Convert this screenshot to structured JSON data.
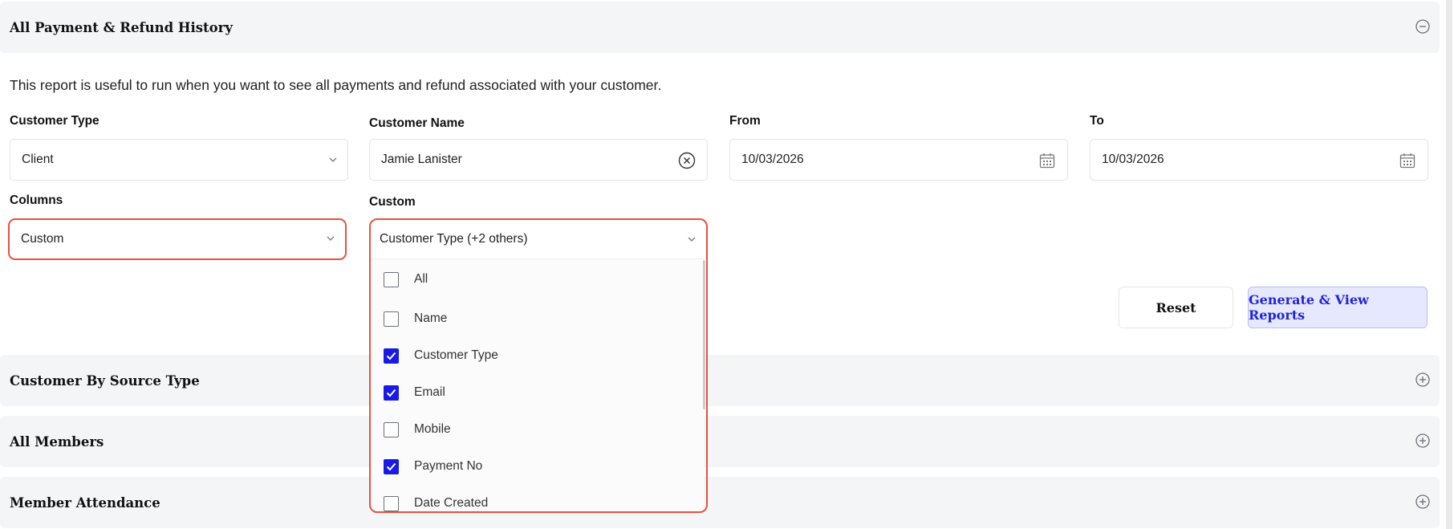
{
  "sections": {
    "payment_refund": {
      "title": "All Payment & Refund History",
      "icon": "minus-circle-icon"
    },
    "source_type": {
      "title": "Customer By Source Type",
      "icon": "plus-circle-icon"
    },
    "all_members": {
      "title": "All Members",
      "icon": "plus-circle-icon"
    },
    "member_attendance": {
      "title": "Member Attendance",
      "icon": "plus-circle-icon"
    }
  },
  "description": "This report is useful to run when you want to see all payments and refund associated with your customer.",
  "form": {
    "customer_type": {
      "label": "Customer Type",
      "value": "Client"
    },
    "customer_name": {
      "label": "Customer Name",
      "value": "Jamie Lanister"
    },
    "from": {
      "label": "From",
      "value": "10/03/2026"
    },
    "to": {
      "label": "To",
      "value": "10/03/2026"
    },
    "columns": {
      "label": "Columns",
      "value": "Custom"
    },
    "custom": {
      "label": "Custom",
      "value": "Customer Type (+2 others)"
    }
  },
  "custom_options": [
    {
      "label": "All",
      "checked": false
    },
    {
      "label": "Name",
      "checked": false
    },
    {
      "label": "Customer Type",
      "checked": true
    },
    {
      "label": "Email",
      "checked": true
    },
    {
      "label": "Mobile",
      "checked": false
    },
    {
      "label": "Payment No",
      "checked": true
    },
    {
      "label": "Date Created",
      "checked": false
    }
  ],
  "buttons": {
    "reset": "Reset",
    "generate": "Generate & View Reports"
  },
  "colors": {
    "highlight": "#e5533e",
    "checkbox_on": "#1a1ae6",
    "generate_bg": "#e6e8ff",
    "generate_text": "#2124d6"
  }
}
